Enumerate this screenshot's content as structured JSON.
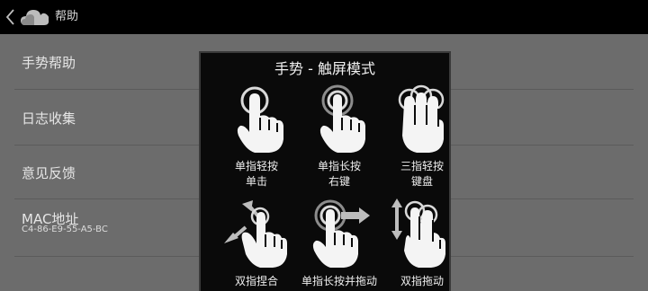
{
  "topbar": {
    "title": "帮助",
    "back_icon": "chevron-left-icon",
    "logo_icon": "cloud-icon"
  },
  "menu": {
    "items": [
      {
        "label": "手势帮助"
      },
      {
        "label": "日志收集"
      },
      {
        "label": "意见反馈"
      },
      {
        "label": "MAC地址",
        "value": "C4-86-E9-55-A5-BC"
      }
    ]
  },
  "dialog": {
    "title": "手势 - 触屏模式",
    "gestures": [
      {
        "line1": "单指轻按",
        "line2": "单击",
        "icon": "single-tap-icon"
      },
      {
        "line1": "单指长按",
        "line2": "右键",
        "icon": "single-long-press-icon"
      },
      {
        "line1": "三指轻按",
        "line2": "键盘",
        "icon": "three-finger-tap-icon"
      },
      {
        "line1": "双指捏合",
        "line2": "",
        "icon": "pinch-icon"
      },
      {
        "line1": "单指长按并拖动",
        "line2": "",
        "icon": "long-press-drag-icon"
      },
      {
        "line1": "双指拖动",
        "line2": "",
        "icon": "two-finger-drag-icon"
      }
    ]
  },
  "colors": {
    "topbar": "#000000",
    "list_bg": "#6c6c6c",
    "dialog_bg": "#0a0a0a",
    "text": "#e6e6e6"
  }
}
